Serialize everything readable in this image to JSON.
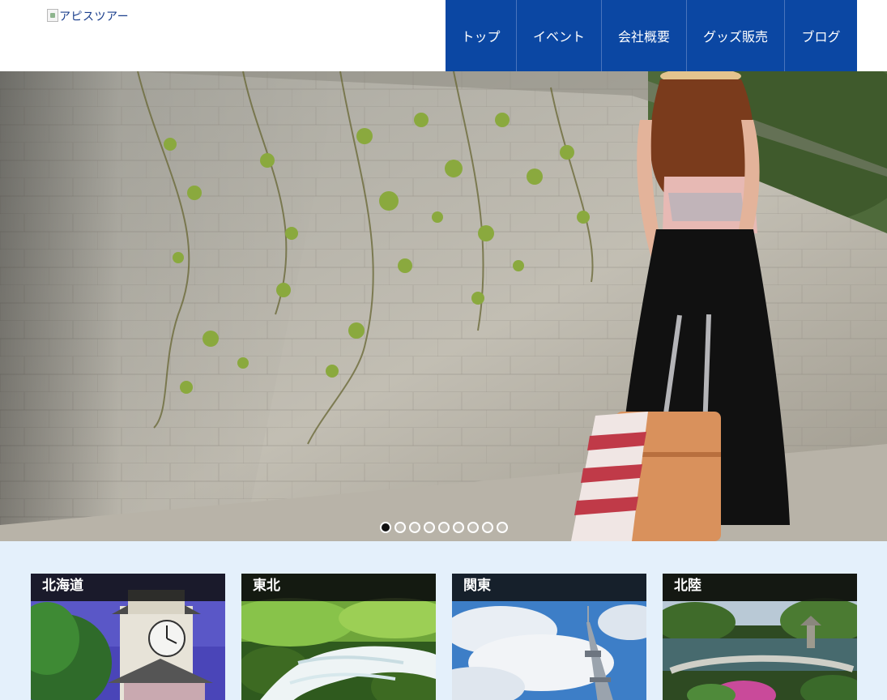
{
  "header": {
    "logo_alt": "アピスツアー"
  },
  "nav": {
    "items": [
      {
        "label": "トップ",
        "w": 88
      },
      {
        "label": "イベント",
        "w": 105
      },
      {
        "label": "会社概要",
        "w": 105
      },
      {
        "label": "グッズ販売",
        "w": 121
      },
      {
        "label": "ブログ",
        "w": 89
      }
    ]
  },
  "slider": {
    "dots": [
      true,
      false,
      false,
      false,
      false,
      false,
      false,
      false,
      false
    ]
  },
  "regions": [
    {
      "title": "北海道",
      "icon": "clock-tower"
    },
    {
      "title": "東北",
      "icon": "waterfall-stream"
    },
    {
      "title": "関東",
      "icon": "skytree"
    },
    {
      "title": "北陸",
      "icon": "japanese-garden"
    }
  ]
}
